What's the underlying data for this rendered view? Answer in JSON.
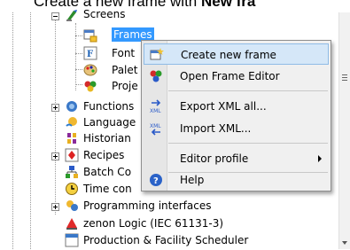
{
  "caption": {
    "prefix": "Create a new frame with ",
    "bold": "New fra"
  },
  "tree": {
    "items": [
      {
        "label": "Screens",
        "icon": "screens-icon"
      },
      {
        "label": "Frames",
        "icon": "frames-icon",
        "selected": true
      },
      {
        "label": "Font",
        "icon": "font-icon"
      },
      {
        "label": "Palet",
        "icon": "palette-icon"
      },
      {
        "label": "Proje",
        "icon": "project-icon"
      },
      {
        "label": "Functions",
        "icon": "functions-icon"
      },
      {
        "label": "Language",
        "icon": "language-icon"
      },
      {
        "label": "Historian",
        "icon": "historian-icon"
      },
      {
        "label": "Recipes",
        "icon": "recipes-icon"
      },
      {
        "label": "Batch Co",
        "icon": "batch-control-icon"
      },
      {
        "label": "Time con",
        "icon": "time-control-icon"
      },
      {
        "label": "Programming interfaces",
        "icon": "programming-interfaces-icon"
      },
      {
        "label": "zenon Logic (IEC 61131-3)",
        "icon": "zenon-logic-icon"
      },
      {
        "label": "Production & Facility Scheduler",
        "icon": "scheduler-icon"
      }
    ]
  },
  "context_menu": {
    "items": [
      {
        "label": "Create new frame",
        "icon": "create-frame-icon",
        "highlighted": true
      },
      {
        "label": "Open Frame Editor",
        "icon": "frame-editor-icon"
      },
      {
        "label": "Export XML all...",
        "icon": "export-xml-icon"
      },
      {
        "label": "Import XML...",
        "icon": "import-xml-icon"
      },
      {
        "label": "Editor profile",
        "icon": "",
        "submenu": true
      },
      {
        "label": "Help",
        "icon": "help-icon"
      }
    ]
  }
}
